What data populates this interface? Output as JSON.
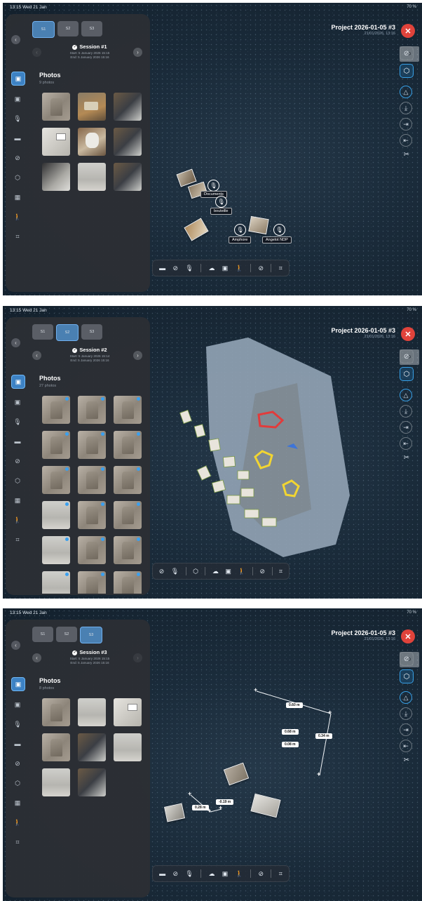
{
  "screens": [
    {
      "status_time": "13:15  Wed 21 Jan",
      "battery": "70 %",
      "project_title": "Project 2026-01-05 #3",
      "project_date": "21/01/2026, 13:16",
      "tabs": [
        "S1",
        "S2",
        "S3"
      ],
      "session_name": "Session #1",
      "session_start": "Start: 5 January 2026 15:15",
      "session_end": "End: 5 January 2026 15:16",
      "panel_title": "Photos",
      "photo_count": "9 photos",
      "markers": [
        "Documents",
        "bouteille",
        "Amphore",
        "Angelot NDP"
      ]
    },
    {
      "status_time": "13:15  Wed 21 Jan",
      "battery": "70 %",
      "project_title": "Project 2026-01-05 #3",
      "project_date": "21/01/2026, 13:16",
      "tabs": [
        "S1",
        "S2",
        "S3"
      ],
      "session_name": "Session #2",
      "session_start": "Start: 5 January 2026 15:14",
      "session_end": "End: 5 January 2026 15:16",
      "panel_title": "Photos",
      "photo_count": "27 photos"
    },
    {
      "status_time": "13:15  Wed 21 Jan",
      "battery": "70 %",
      "project_title": "Project 2026-01-05 #3",
      "project_date": "21/01/2026, 13:16",
      "tabs": [
        "S1",
        "S2",
        "S3"
      ],
      "session_name": "Session #3",
      "session_start": "Start: 5 January 2026 15:15",
      "session_end": "End: 5 January 2026 15:16",
      "panel_title": "Photos",
      "photo_count": "8 photos",
      "measurements": [
        "0.60 m",
        "0.68 m",
        "0.08 m",
        "0.34 m",
        "0.28 m",
        "-0.19 m"
      ]
    }
  ],
  "icons": {
    "back": "‹",
    "next": "›",
    "close": "✕",
    "check": "✓",
    "start": "◉",
    "end": "◉",
    "mic": "🎙",
    "photo": "▣",
    "ruler": "▬",
    "compass": "⊘",
    "cube": "⬡",
    "grid": "▦",
    "walk": "🚶",
    "scan": "⌗",
    "cloud": "☁",
    "camera": "📷",
    "scissors": "✂",
    "arrow_down": "⤓",
    "arrow_right": "⇥",
    "arrow_left": "⇤",
    "triangle": "△"
  },
  "colors": {
    "accent": "#3d82c4",
    "close": "#e0433b",
    "panel": "#2c2f34",
    "scene": "#1a2b3a"
  }
}
